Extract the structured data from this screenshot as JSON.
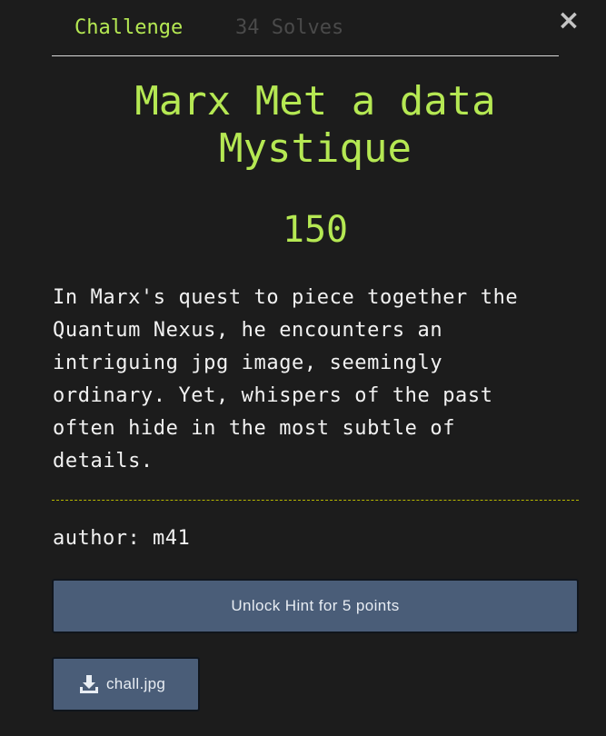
{
  "tabs": {
    "challenge": "Challenge",
    "solves": "34 Solves"
  },
  "close_icon": "close-icon",
  "challenge": {
    "title": "Marx Met a data Mystique",
    "points": "150",
    "description": "In Marx's quest to piece together the\nQuantum Nexus, he encounters an\nintriguing jpg image, seemingly\nordinary. Yet, whispers of the past\noften hide in the most subtle of\ndetails.",
    "author": "author: m41"
  },
  "hint": {
    "label": "Unlock Hint for 5 points"
  },
  "file": {
    "name": "chall.jpg",
    "icon": "download-icon"
  },
  "colors": {
    "background": "#1c1c1c",
    "accent": "#b5e853",
    "button": "#4a5d78",
    "text": "#f2f2f2"
  }
}
